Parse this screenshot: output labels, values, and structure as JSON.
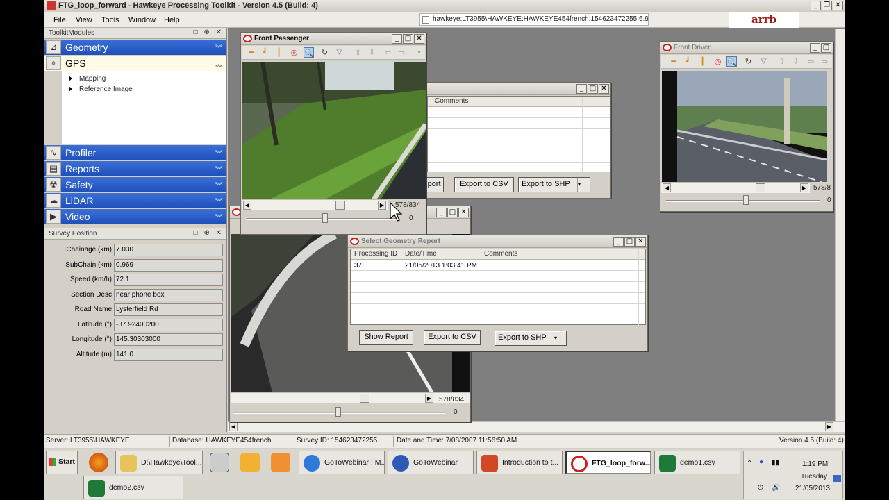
{
  "app": {
    "title": "FTG_loop_forward - Hawkeye Processing Toolkit - Version 4.5 (Build: 4)",
    "menu": [
      "File",
      "View",
      "Tools",
      "Window",
      "Help"
    ],
    "address": "hawkeye:LT3955\\HAWKEYE:HAWKEYE454french:154623472255:6.9",
    "logo": "arrb"
  },
  "toolkit_panel": {
    "title": "ToolkitModules",
    "modules": [
      {
        "label": "Geometry",
        "icon": "geometry-icon"
      },
      {
        "label": "GPS",
        "icon": "gps-icon",
        "expanded": true
      },
      {
        "label": "Profiler",
        "icon": "profiler-icon"
      },
      {
        "label": "Reports",
        "icon": "reports-icon"
      },
      {
        "label": "Safety",
        "icon": "safety-icon"
      },
      {
        "label": "LiDAR",
        "icon": "lidar-icon"
      },
      {
        "label": "Video",
        "icon": "video-camera-icon"
      }
    ],
    "gps_items": [
      "Mapping",
      "Reference Image"
    ]
  },
  "survey_position": {
    "title": "Survey Position",
    "fields": [
      {
        "label": "Chainage (km)",
        "value": "7.030"
      },
      {
        "label": "SubChain (km)",
        "value": "0.969"
      },
      {
        "label": "Speed (km/h)",
        "value": "72.1"
      },
      {
        "label": "Section Desc",
        "value": "near phone box"
      },
      {
        "label": "Road Name",
        "value": "Lysterfield Rd"
      },
      {
        "label": "Latitude (°)",
        "value": "-37.92400200"
      },
      {
        "label": "Longitude (°)",
        "value": "145.30303000"
      },
      {
        "label": "Altitude (m)",
        "value": "141.0"
      }
    ]
  },
  "front_passenger": {
    "title": "Front Passenger",
    "counter": "578/834",
    "slider_value": "0"
  },
  "front_driver": {
    "title": "Front Driver",
    "counter": "578/8",
    "slider_value": "0"
  },
  "rear_window": {
    "counter": "578/834",
    "slider_value": "0"
  },
  "geometry_report_bg": {
    "columns": [
      "Comments"
    ],
    "buttons": {
      "show": "eport",
      "csv": "Export to CSV",
      "shp": "Export to SHP"
    }
  },
  "geometry_report": {
    "title": "Select Geometry Report",
    "columns": [
      "Processing ID",
      "Date/Time",
      "Comments"
    ],
    "rows": [
      {
        "id": "37",
        "datetime": "21/05/2013 1:03:41 PM",
        "comments": ""
      }
    ],
    "buttons": {
      "show": "Show Report",
      "csv": "Export to CSV",
      "shp": "Export to SHP"
    }
  },
  "status_bar": {
    "server": "Server: LT3955\\HAWKEYE",
    "database": "Database: HAWKEYE454french",
    "survey": "Survey ID: 154623472255",
    "datetime": "Date and Time: 7/08/2007 11:56:50 AM",
    "version": "Version 4.5 (Build: 4)"
  },
  "taskbar": {
    "start": "Start",
    "tasks": [
      "D:\\Hawkeye\\Tool...",
      "GoToWebinar : M...",
      "GoToWebinar",
      "Introduction to t...",
      "FTG_loop_forw...",
      "demo1.csv",
      "demo2.csv"
    ],
    "clock": {
      "time": "1:19 PM",
      "day": "Tuesday",
      "date": "21/05/2013"
    }
  },
  "colors": {
    "module_blue": "#2a5bc9",
    "mdi_background": "#7f7f7f",
    "logo_red": "#a01818"
  }
}
